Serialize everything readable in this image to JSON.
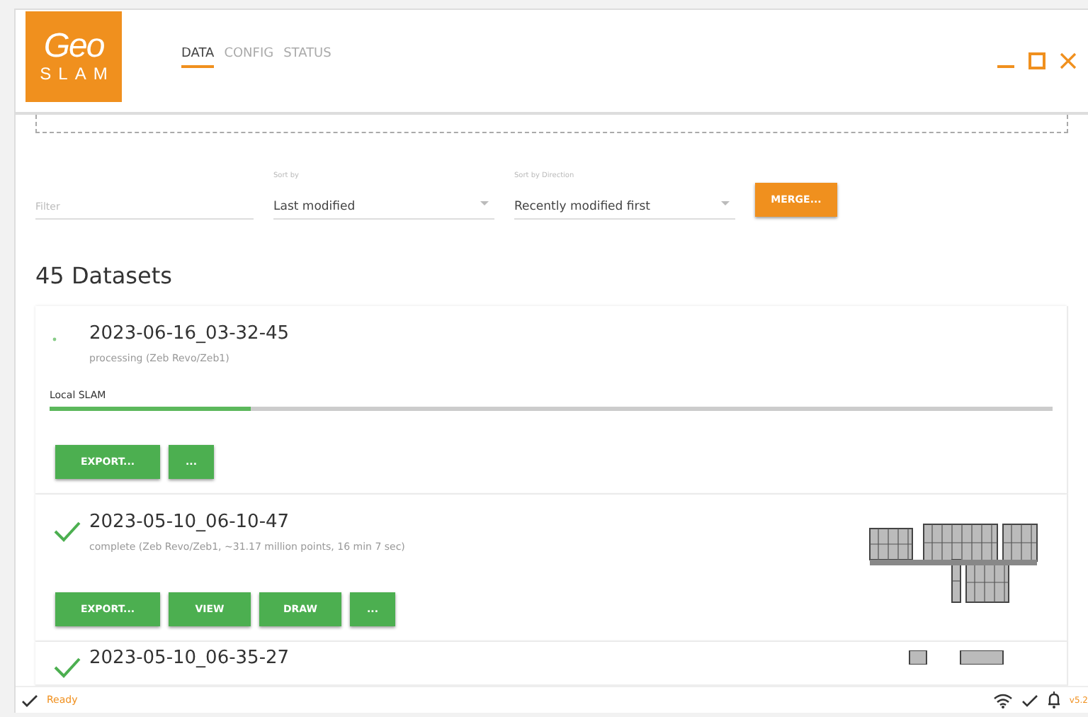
{
  "app": {
    "logo_top": "Geo",
    "logo_bottom": "SLAM",
    "tabs": [
      {
        "label": "DATA",
        "selected": true
      },
      {
        "label": "CONFIG",
        "selected": false
      },
      {
        "label": "STATUS",
        "selected": false
      }
    ]
  },
  "toolbar": {
    "filter": {
      "placeholder": "Filter"
    },
    "sort_by": {
      "label": "Sort by",
      "value": "Last modified"
    },
    "sort_direction": {
      "label": "Sort by Direction",
      "value": "Recently modified first"
    },
    "merge_button": "MERGE..."
  },
  "heading": "45 Datasets",
  "datasets": [
    {
      "kind": "processing",
      "title": "2023-06-16_03-32-45",
      "subtitle": "processing (Zeb Revo/Zeb1)",
      "stage": "Local SLAM",
      "level": 0.2,
      "buttons": [
        "EXPORT...",
        "..."
      ]
    },
    {
      "kind": "complete",
      "title": "2023-05-10_06-10-47",
      "subtitle": "complete (Zeb Revo/Zeb1, ~31.17 million points, 16 min 7 sec)",
      "buttons": [
        "EXPORT...",
        "VIEW",
        "DRAW",
        "..."
      ]
    },
    {
      "kind": "complete",
      "title": "2023-05-10_06-35-27"
    }
  ],
  "status_bar": {
    "status": "Ready",
    "version": "v5.2"
  }
}
